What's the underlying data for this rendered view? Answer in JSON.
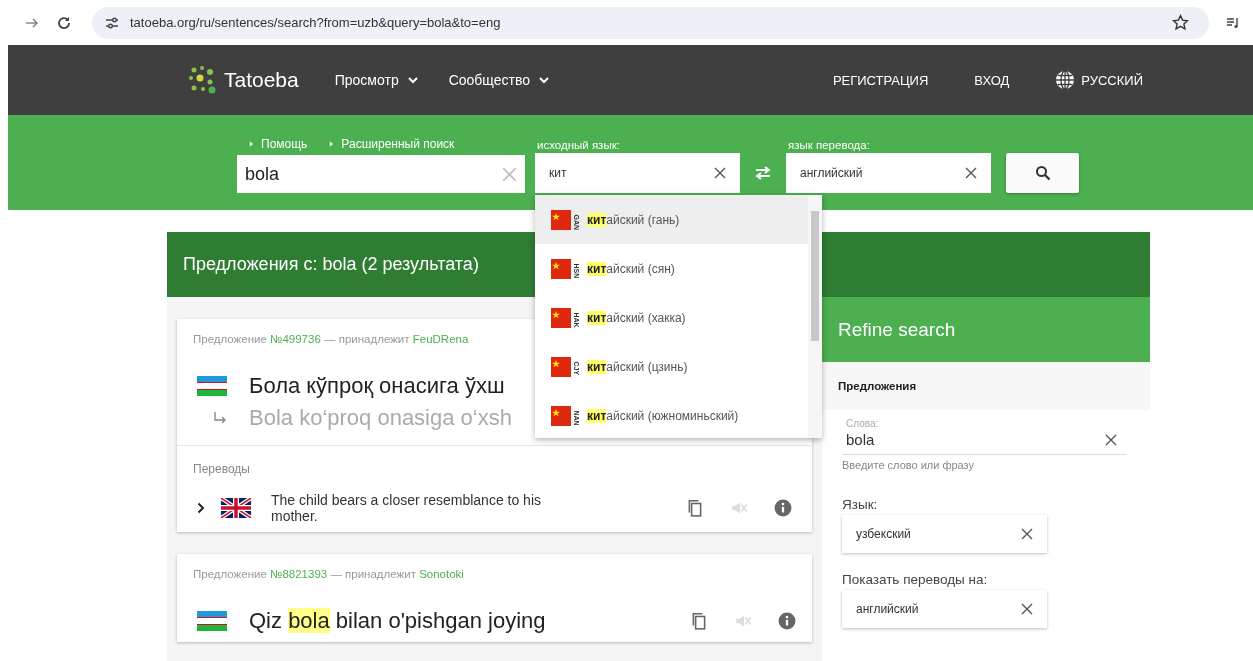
{
  "browser": {
    "url": "tatoeba.org/ru/sentences/search?from=uzb&query=bola&to=eng"
  },
  "nav": {
    "logo": "Tatoeba",
    "menus": [
      {
        "label": "Просмотр"
      },
      {
        "label": "Сообщество"
      }
    ],
    "links": [
      "РЕГИСТРАЦИЯ",
      "ВХОД"
    ],
    "language": "РУССКИЙ"
  },
  "search": {
    "links": [
      "Помощь",
      "Расширенный поиск"
    ],
    "query": "bola",
    "from": {
      "label": "исходный язык:",
      "value": "кит"
    },
    "to": {
      "label": "язык перевода:",
      "value": "английский"
    }
  },
  "dropdown": {
    "items": [
      {
        "code": "GAN",
        "match": "кит",
        "rest": "айский (гань)",
        "selected": true
      },
      {
        "code": "HSN",
        "match": "кит",
        "rest": "айский (сян)",
        "selected": false
      },
      {
        "code": "HAK",
        "match": "кит",
        "rest": "айский (хакка)",
        "selected": false
      },
      {
        "code": "CJY",
        "match": "кит",
        "rest": "айский (цзинь)",
        "selected": false
      },
      {
        "code": "NAN",
        "match": "кит",
        "rest": "айский (южноминьский)",
        "selected": false
      }
    ]
  },
  "results": {
    "title": "Предложения с: bola (2 результата)",
    "sentences": [
      {
        "label": "Предложение",
        "number": "№499736",
        "owner_label": "— принадлежит",
        "owner": "FeuDRena",
        "parts": [
          {
            "text": "Бола кўпроқ онасига ўхш",
            "highlight": false
          }
        ],
        "transcription": "Bola ko‘proq onasiga o‘xsh",
        "translations_label": "Переводы",
        "translations": [
          {
            "text": "The child bears a closer resemblance to his mother."
          }
        ]
      },
      {
        "label": "Предложение",
        "number": "№8821393",
        "owner_label": "— принадлежит",
        "owner": "Sonotoki",
        "parts": [
          {
            "text": "Qiz ",
            "highlight": false
          },
          {
            "text": "bola",
            "highlight": true
          },
          {
            "text": " bilan o'pishgan joying",
            "highlight": false
          }
        ],
        "actions": true
      }
    ]
  },
  "refine": {
    "title": "Refine search",
    "section": "Предложения",
    "words": {
      "label": "Слова:",
      "value": "bola",
      "hint": "Введите слово или фразу"
    },
    "language": {
      "label": "Язык:",
      "value": "узбекский"
    },
    "show": {
      "label": "Показать переводы на:",
      "value": "английский"
    }
  }
}
